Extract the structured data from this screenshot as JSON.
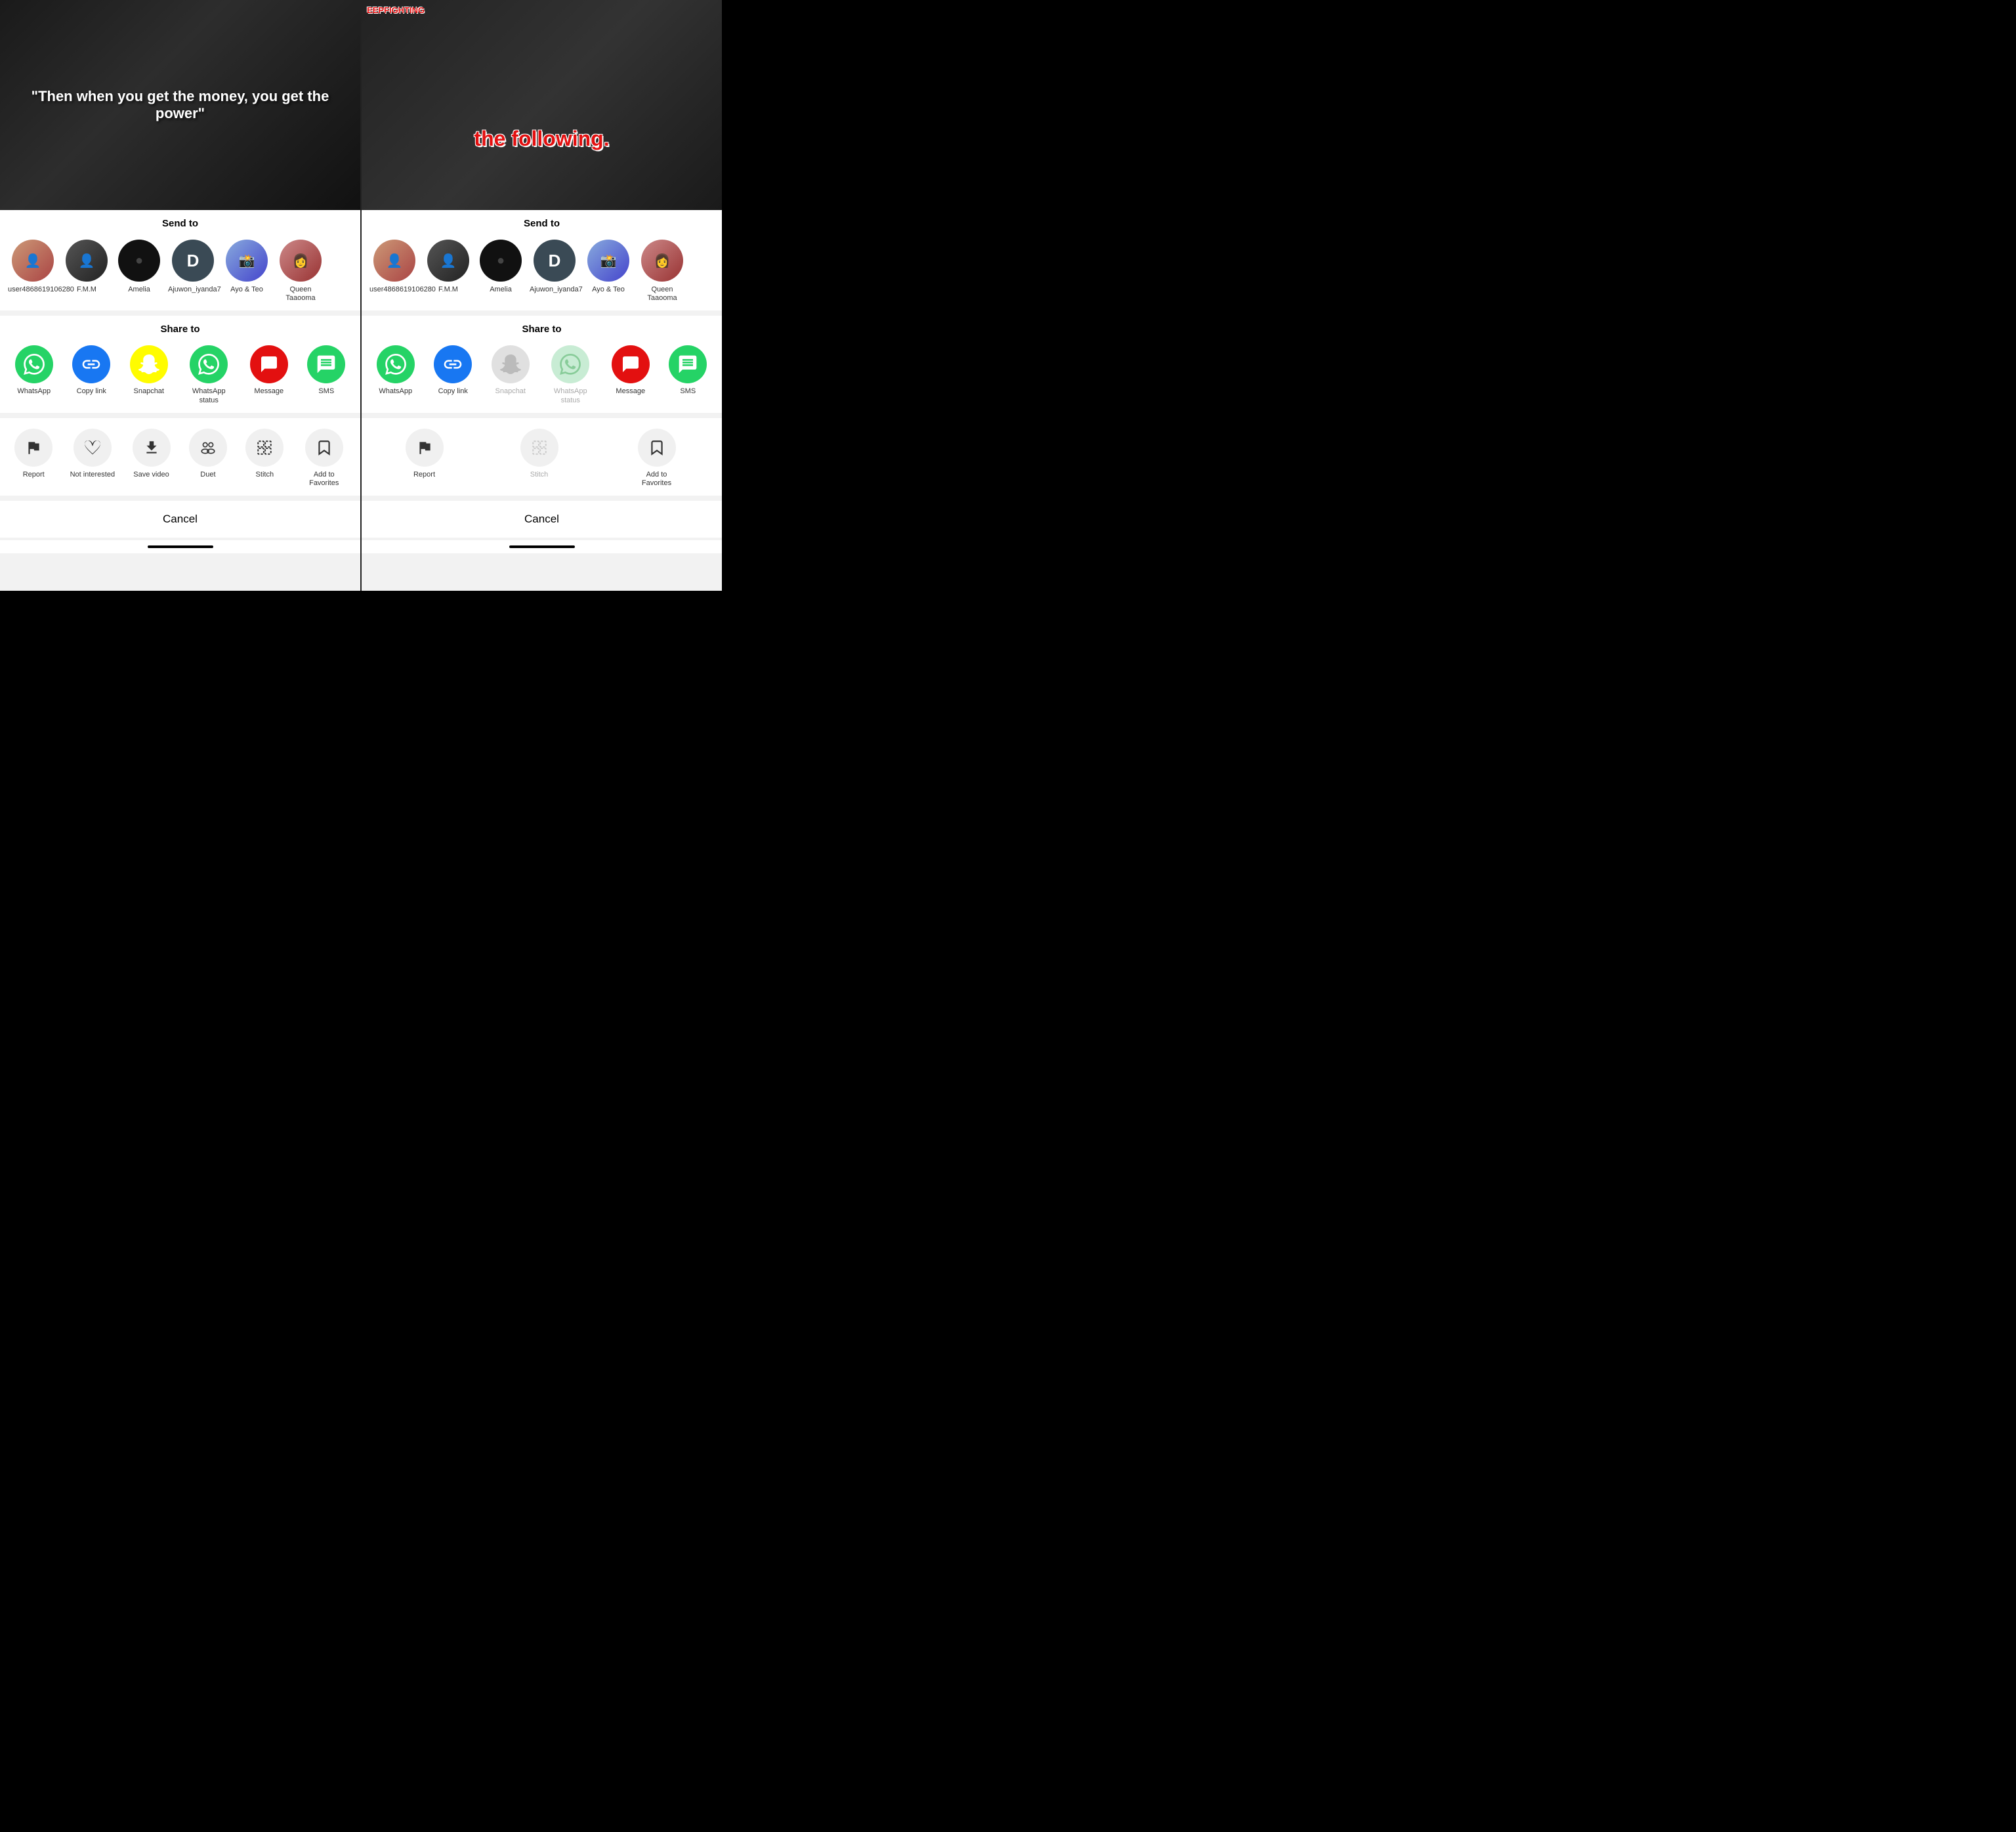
{
  "panels": [
    {
      "id": "left",
      "video": {
        "quote": "\"Then when you get the money, you get the power\"",
        "hashtag": null
      },
      "sendTo": {
        "title": "Send to",
        "contacts": [
          {
            "id": "user1",
            "name": "user4868619106280",
            "avatarType": "user1",
            "letter": ""
          },
          {
            "id": "fmm",
            "name": "F.M.M",
            "avatarType": "fmm",
            "letter": ""
          },
          {
            "id": "amelia",
            "name": "Amelia",
            "avatarType": "amelia",
            "letter": ""
          },
          {
            "id": "ajuwon",
            "name": "Ajuwon_iyanda7",
            "avatarType": "d",
            "letter": "D"
          },
          {
            "id": "ayo",
            "name": "Ayo & Teo",
            "avatarType": "ayo",
            "letter": ""
          },
          {
            "id": "queen",
            "name": "Queen Taaooma",
            "avatarType": "queen",
            "letter": ""
          }
        ]
      },
      "shareTo": {
        "title": "Share to",
        "items": [
          {
            "id": "whatsapp",
            "label": "WhatsApp",
            "iconType": "whatsapp",
            "enabled": true
          },
          {
            "id": "copylink",
            "label": "Copy link",
            "iconType": "copylink",
            "enabled": true
          },
          {
            "id": "snapchat",
            "label": "Snapchat",
            "iconType": "snapchat",
            "enabled": true
          },
          {
            "id": "whatsapp-status",
            "label": "WhatsApp status",
            "iconType": "whatsapp-status",
            "enabled": true
          },
          {
            "id": "message",
            "label": "Message",
            "iconType": "message",
            "enabled": true
          },
          {
            "id": "sms",
            "label": "SMS",
            "iconType": "sms",
            "enabled": true
          }
        ]
      },
      "actions": {
        "items": [
          {
            "id": "report",
            "label": "Report",
            "icon": "flag",
            "enabled": true
          },
          {
            "id": "not-interested",
            "label": "Not interested",
            "icon": "heart-broken",
            "enabled": true
          },
          {
            "id": "save-video",
            "label": "Save video",
            "icon": "download",
            "enabled": true
          },
          {
            "id": "duet",
            "label": "Duet",
            "icon": "duet",
            "enabled": true
          },
          {
            "id": "stitch",
            "label": "Stitch",
            "icon": "stitch",
            "enabled": true
          },
          {
            "id": "add-favorites",
            "label": "Add to Favorites",
            "icon": "bookmark",
            "enabled": true
          }
        ]
      },
      "cancel": "Cancel"
    },
    {
      "id": "right",
      "video": {
        "quote": "the following.",
        "hashtag": "EEPFIGHTING"
      },
      "sendTo": {
        "title": "Send to",
        "contacts": [
          {
            "id": "user1",
            "name": "user4868619106280",
            "avatarType": "user1",
            "letter": ""
          },
          {
            "id": "fmm",
            "name": "F.M.M",
            "avatarType": "fmm",
            "letter": ""
          },
          {
            "id": "amelia",
            "name": "Amelia",
            "avatarType": "amelia",
            "letter": ""
          },
          {
            "id": "ajuwon",
            "name": "Ajuwon_iyanda7",
            "avatarType": "d",
            "letter": "D"
          },
          {
            "id": "ayo",
            "name": "Ayo & Teo",
            "avatarType": "ayo",
            "letter": ""
          },
          {
            "id": "queen",
            "name": "Queen Taaooma",
            "avatarType": "queen",
            "letter": ""
          }
        ]
      },
      "shareTo": {
        "title": "Share to",
        "items": [
          {
            "id": "whatsapp",
            "label": "WhatsApp",
            "iconType": "whatsapp",
            "enabled": true
          },
          {
            "id": "copylink",
            "label": "Copy link",
            "iconType": "copylink",
            "enabled": true
          },
          {
            "id": "snapchat",
            "label": "Snapchat",
            "iconType": "snapchat-gray",
            "enabled": false
          },
          {
            "id": "whatsapp-status",
            "label": "WhatsApp status",
            "iconType": "whatsapp-status-gray",
            "enabled": false
          },
          {
            "id": "message",
            "label": "Message",
            "iconType": "message",
            "enabled": true
          },
          {
            "id": "sms",
            "label": "SMS",
            "iconType": "sms",
            "enabled": true
          }
        ]
      },
      "actions": {
        "items": [
          {
            "id": "report",
            "label": "Report",
            "icon": "flag",
            "enabled": true
          },
          {
            "id": "stitch",
            "label": "Stitch",
            "icon": "stitch",
            "enabled": false
          },
          {
            "id": "add-favorites",
            "label": "Add to Favorites",
            "icon": "bookmark",
            "enabled": true
          }
        ]
      },
      "cancel": "Cancel"
    }
  ]
}
